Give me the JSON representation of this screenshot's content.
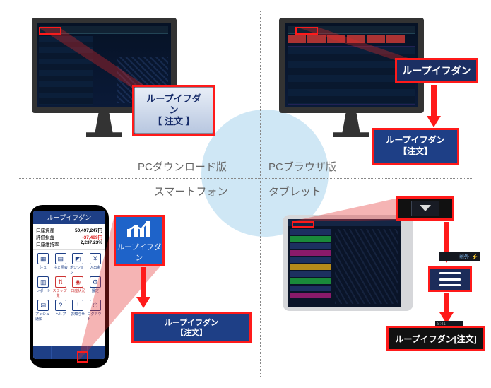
{
  "quadrants": {
    "top_left_label": "PCダウンロード版",
    "top_right_label": "PCブラウザ版",
    "bottom_left_label": "スマートフォン",
    "bottom_right_label": "タブレット"
  },
  "pc_download": {
    "callout_line1": "ループイフダン",
    "callout_line2": "【 注文 】"
  },
  "pc_browser": {
    "tab_callout": "ループイフダン",
    "order_button_line1": "ループイフダン",
    "order_button_line2": "【注文】"
  },
  "smartphone": {
    "app_title": "ループイフダン",
    "rows": [
      {
        "label": "口座資産",
        "value": "50,497,247円"
      },
      {
        "label": "評価損益",
        "value": "-37,489円",
        "neg": true
      },
      {
        "label": "口座維持率",
        "value": "2,237.23%"
      }
    ],
    "icons_row1": [
      "注文",
      "注文照会",
      "ポジション",
      "入出金"
    ],
    "icons_row2": [
      "レポート",
      "スワップ一覧",
      "口座状況",
      "設定"
    ],
    "icons_row3": [
      "プッシュ通知",
      "ヘルプ",
      "お知らせ",
      "ログアウト"
    ],
    "callout_icon_label": "ループイフダン",
    "order_button_line1": "ループイフダン",
    "order_button_line2": "【注文】"
  },
  "tablet": {
    "status_text": "圏外 ⚡",
    "time_text": "8:41",
    "order_button": "ループイフダン[注文]"
  }
}
